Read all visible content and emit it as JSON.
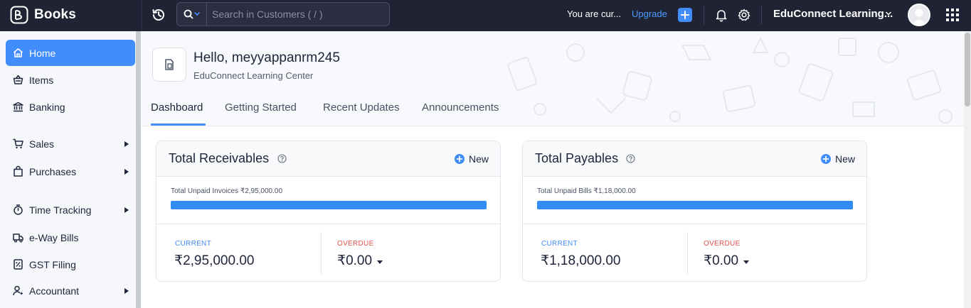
{
  "app": {
    "name": "Books"
  },
  "topbar": {
    "search_placeholder": "Search in Customers ( / )",
    "trial_text": "You are cur...",
    "upgrade_label": "Upgrade",
    "org_name": "EduConnect Learning..."
  },
  "sidebar": {
    "items": [
      {
        "label": "Home",
        "icon": "home-icon",
        "active": true,
        "has_submenu": false
      },
      {
        "label": "Items",
        "icon": "basket-icon",
        "active": false,
        "has_submenu": false
      },
      {
        "label": "Banking",
        "icon": "bank-icon",
        "active": false,
        "has_submenu": false
      },
      {
        "label": "Sales",
        "icon": "cart-icon",
        "active": false,
        "has_submenu": true
      },
      {
        "label": "Purchases",
        "icon": "bag-icon",
        "active": false,
        "has_submenu": true
      },
      {
        "label": "Time Tracking",
        "icon": "stopwatch-icon",
        "active": false,
        "has_submenu": true
      },
      {
        "label": "e-Way Bills",
        "icon": "truck-icon",
        "active": false,
        "has_submenu": false
      },
      {
        "label": "GST Filing",
        "icon": "percent-doc-icon",
        "active": false,
        "has_submenu": false
      },
      {
        "label": "Accountant",
        "icon": "accountant-icon",
        "active": false,
        "has_submenu": true
      }
    ]
  },
  "header": {
    "greeting": "Hello, meyyappanrm245",
    "org_subtitle": "EduConnect Learning Center",
    "tabs": [
      {
        "label": "Dashboard",
        "active": true
      },
      {
        "label": "Getting Started",
        "active": false
      },
      {
        "label": "Recent Updates",
        "active": false
      },
      {
        "label": "Announcements",
        "active": false
      }
    ]
  },
  "cards": {
    "receivables": {
      "title": "Total Receivables",
      "new_label": "New",
      "unpaid_label": "Total Unpaid Invoices ₹2,95,000.00",
      "progress_current_fraction": 1.0,
      "current_label": "CURRENT",
      "current_value": "₹2,95,000.00",
      "overdue_label": "OVERDUE",
      "overdue_value": "₹0.00"
    },
    "payables": {
      "title": "Total Payables",
      "new_label": "New",
      "unpaid_label": "Total Unpaid Bills ₹1,18,000.00",
      "progress_current_fraction": 1.0,
      "current_label": "CURRENT",
      "current_value": "₹1,18,000.00",
      "overdue_label": "OVERDUE",
      "overdue_value": "₹0.00"
    }
  },
  "colors": {
    "accent": "#408dfb",
    "topbar_bg": "#1f2333",
    "progress_fill": "#2f8df5",
    "overdue": "#e8504a"
  }
}
